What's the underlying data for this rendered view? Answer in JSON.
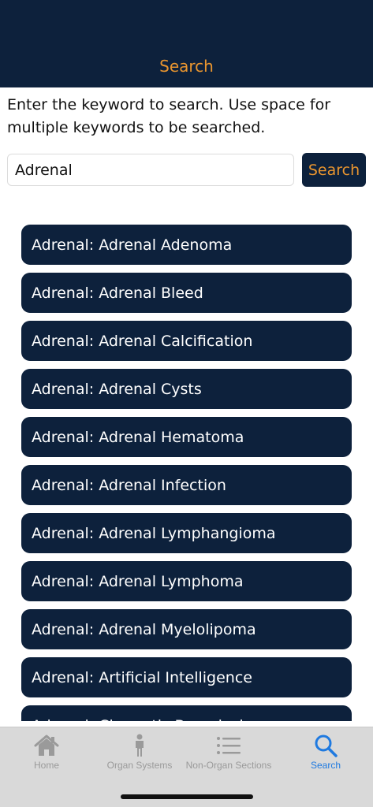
{
  "header": {
    "title": "Search"
  },
  "instructions": "Enter the keyword to search. Use space for multiple keywords to be searched.",
  "search": {
    "value": "Adrenal",
    "button_label": "Search"
  },
  "results": [
    "Adrenal: Adrenal Adenoma",
    "Adrenal: Adrenal Bleed",
    "Adrenal: Adrenal Calcification",
    "Adrenal: Adrenal Cysts",
    "Adrenal: Adrenal Hematoma",
    "Adrenal: Adrenal Infection",
    "Adrenal: Adrenal Lymphangioma",
    "Adrenal: Adrenal Lymphoma",
    "Adrenal: Adrenal Myelolipoma",
    "Adrenal: Artificial Intelligence",
    "Adrenal: Chemotic Brucelosis"
  ],
  "tabbar": {
    "tabs": [
      {
        "label": "Home",
        "icon": "home-icon",
        "active": false
      },
      {
        "label": "Organ Systems",
        "icon": "person-icon",
        "active": false
      },
      {
        "label": "Non-Organ Sections",
        "icon": "list-icon",
        "active": false
      },
      {
        "label": "Search",
        "icon": "search-icon",
        "active": true
      }
    ]
  },
  "colors": {
    "navy": "#0d213c",
    "accent": "#e9952f",
    "active_tab": "#1f7ae0",
    "inactive_tab": "#9a9a9a"
  }
}
